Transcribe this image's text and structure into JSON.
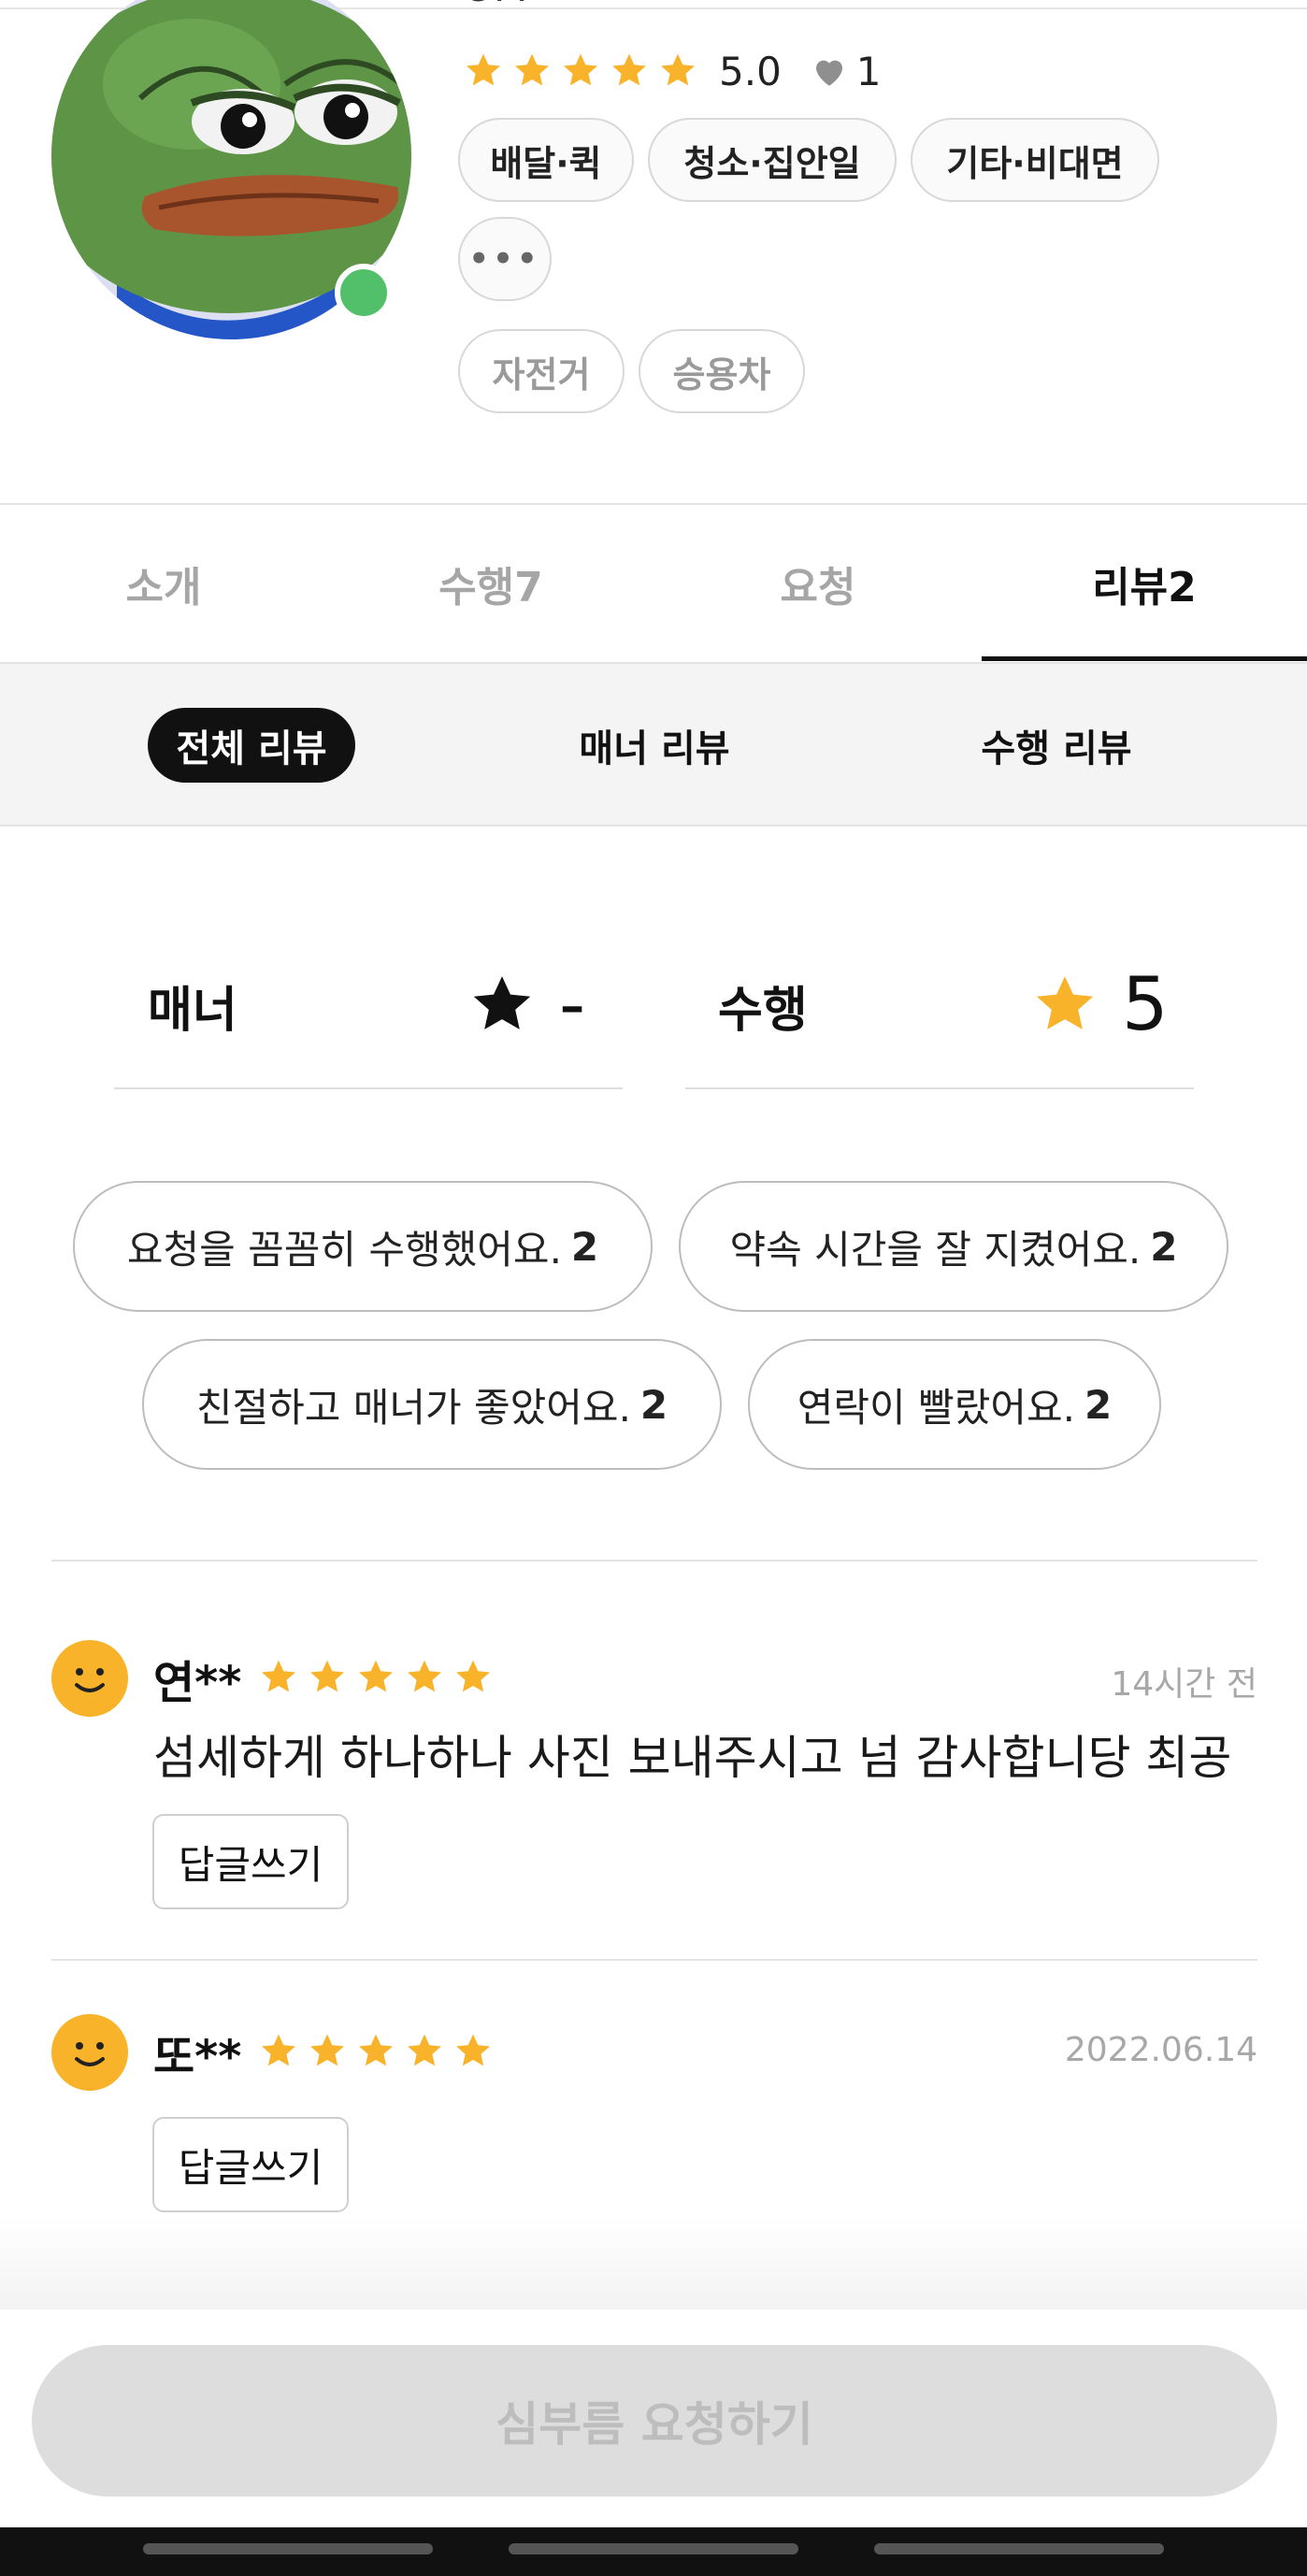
{
  "profile": {
    "name_partial": "OM",
    "rating": "5.0",
    "likes": "1",
    "online": true,
    "categories": [
      "배달·퀵",
      "청소·집안일",
      "기타·비대면"
    ],
    "more_label": "•••",
    "vehicles": [
      "자전거",
      "승용차"
    ]
  },
  "tabs": [
    {
      "label": "소개",
      "active": false
    },
    {
      "label": "수행7",
      "active": false
    },
    {
      "label": "요청",
      "active": false
    },
    {
      "label": "리뷰2",
      "active": true
    }
  ],
  "review_filters": [
    {
      "label": "전체 리뷰",
      "active": true
    },
    {
      "label": "매너 리뷰",
      "active": false
    },
    {
      "label": "수행 리뷰",
      "active": false
    }
  ],
  "scores": {
    "manner": {
      "label": "매너",
      "value": "-",
      "star_color": "#111111"
    },
    "perform": {
      "label": "수행",
      "value": "5",
      "star_color": "#f9b32a"
    }
  },
  "keywords": [
    {
      "text": "요청을 꼼꼼히 수행했어요.",
      "count": "2"
    },
    {
      "text": "약속 시간을 잘 지켰어요.",
      "count": "2"
    },
    {
      "text": "친절하고 매너가 좋았어요.",
      "count": "2"
    },
    {
      "text": "연락이 빨랐어요.",
      "count": "2"
    }
  ],
  "reviews": [
    {
      "name": "연**",
      "stars": 5,
      "date": "14시간 전",
      "text": "섬세하게 하나하나 사진 보내주시고 넘 감사합니당 최공",
      "reply_label": "답글쓰기"
    },
    {
      "name": "또**",
      "stars": 5,
      "date": "2022.06.14",
      "text": "",
      "reply_label": "답글쓰기"
    }
  ],
  "cta": {
    "label": "심부름 요청하기",
    "enabled": false
  },
  "colors": {
    "star": "#f9b32a",
    "online": "#52c06b",
    "accent_dark": "#111111"
  },
  "icons": {
    "star": "star-icon",
    "heart": "heart-icon",
    "smiley": "smiley-avatar-icon"
  }
}
